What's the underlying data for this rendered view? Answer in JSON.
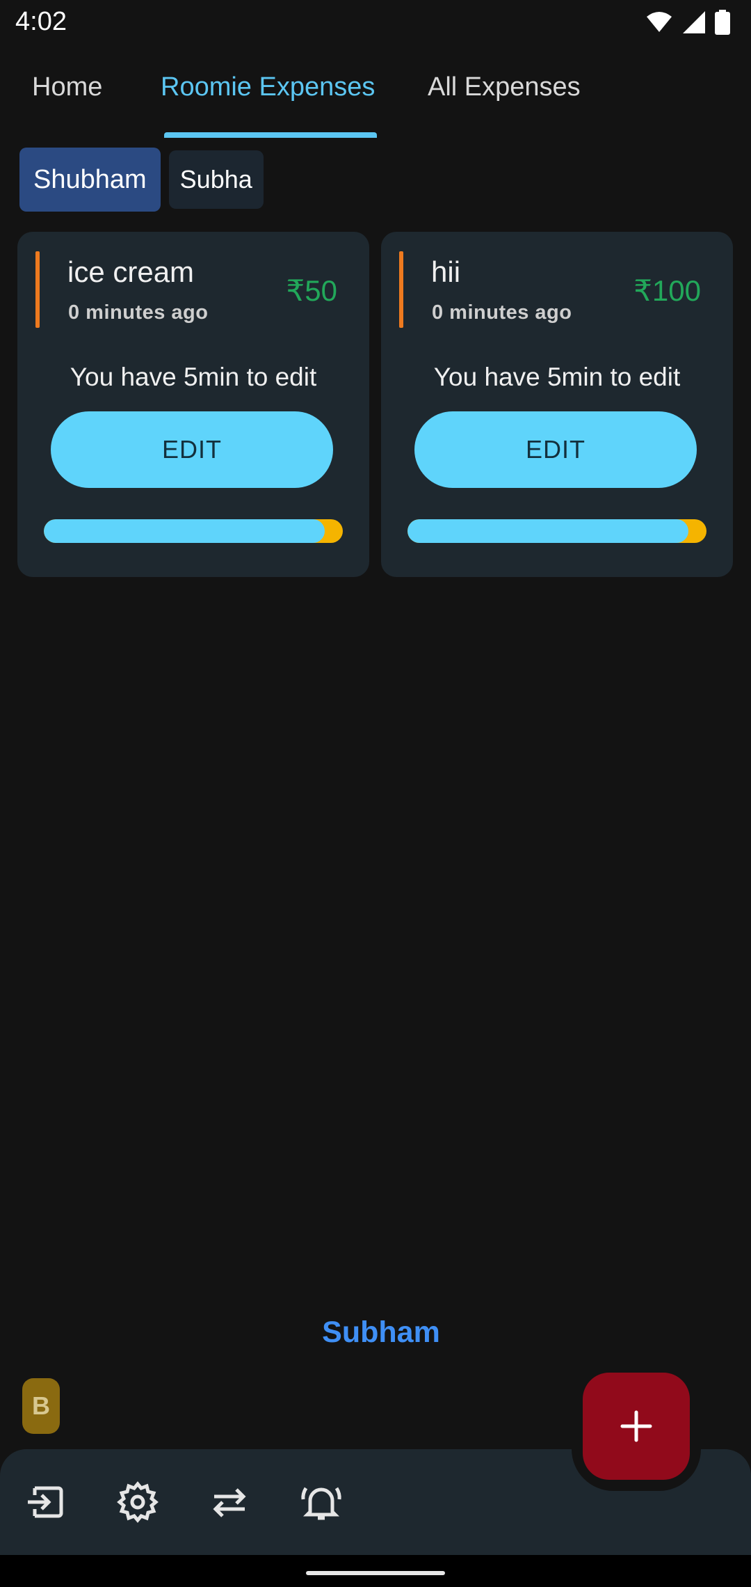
{
  "status_bar": {
    "time": "4:02",
    "icons": [
      "wifi-icon",
      "signal-icon",
      "battery-icon"
    ]
  },
  "tabs": [
    {
      "label": "Home",
      "active": false
    },
    {
      "label": "Roomie Expenses",
      "active": true
    },
    {
      "label": "All Expenses",
      "active": false
    }
  ],
  "roomies": [
    {
      "label": "Shubham",
      "selected": true
    },
    {
      "label": "Subha",
      "selected": false
    }
  ],
  "expenses": [
    {
      "title": "ice cream",
      "time": "0 minutes ago",
      "amount": "₹50",
      "note": "You have 5min to edit",
      "edit_label": "EDIT",
      "progress_percent": 94
    },
    {
      "title": "hii",
      "time": "0 minutes ago",
      "amount": "₹100",
      "note": "You have 5min to edit",
      "edit_label": "EDIT",
      "progress_percent": 94
    }
  ],
  "user": {
    "name": "Subham",
    "avatar_letter": "B"
  },
  "bottom_bar": {
    "icons": [
      "logout-icon",
      "settings-icon",
      "swap-icon",
      "notification-bell-icon"
    ],
    "fab_icon": "add-icon"
  },
  "colors": {
    "accent": "#5cc6f2",
    "button": "#5fd4fb",
    "amount": "#22a85a",
    "fab": "#910a1b",
    "progress_remaining": "#f5b400",
    "username": "#3f8ff5"
  }
}
